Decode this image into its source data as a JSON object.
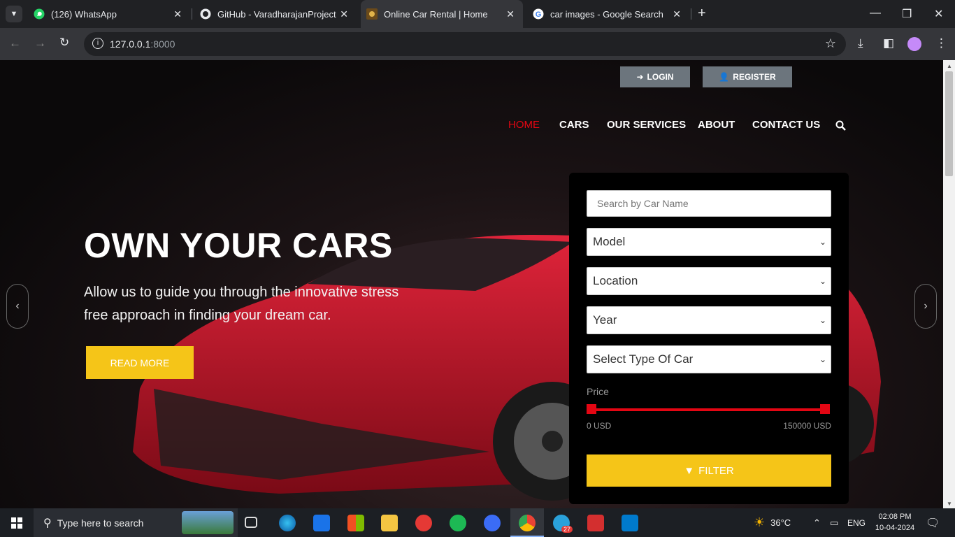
{
  "browser": {
    "tabs": [
      {
        "title": "(126) WhatsApp",
        "icon": "whatsapp-icon"
      },
      {
        "title": "GitHub - VaradharajanProjects/",
        "icon": "github-icon"
      },
      {
        "title": "Online Car Rental | Home",
        "icon": "site-icon",
        "active": true
      },
      {
        "title": "car images - Google Search",
        "icon": "google-icon"
      }
    ],
    "url_host": "127.0.0.1",
    "url_port": ":8000"
  },
  "site": {
    "login_label": "LOGIN",
    "register_label": "REGISTER",
    "nav": [
      "HOME",
      "CARS",
      "OUR SERVICES",
      "ABOUT",
      "CONTACT US"
    ],
    "hero_title": "OWN YOUR CARS",
    "hero_text": "Allow us to guide you through the innovative stress free approach in finding your dream car.",
    "read_more": "READ MORE",
    "accent_color": "#f5c518",
    "active_nav_color": "#e30613"
  },
  "filter": {
    "search_placeholder": "Search by Car Name",
    "selects": [
      "Model",
      "Location",
      "Year",
      "Select Type Of Car"
    ],
    "price_label": "Price",
    "price_min": "0 USD",
    "price_max": "150000 USD",
    "button": "FILTER"
  },
  "taskbar": {
    "search_placeholder": "Type here to search",
    "weather": "36°C",
    "lang": "ENG",
    "time": "02:08 PM",
    "date": "10-04-2024",
    "telegram_badge": "27"
  }
}
